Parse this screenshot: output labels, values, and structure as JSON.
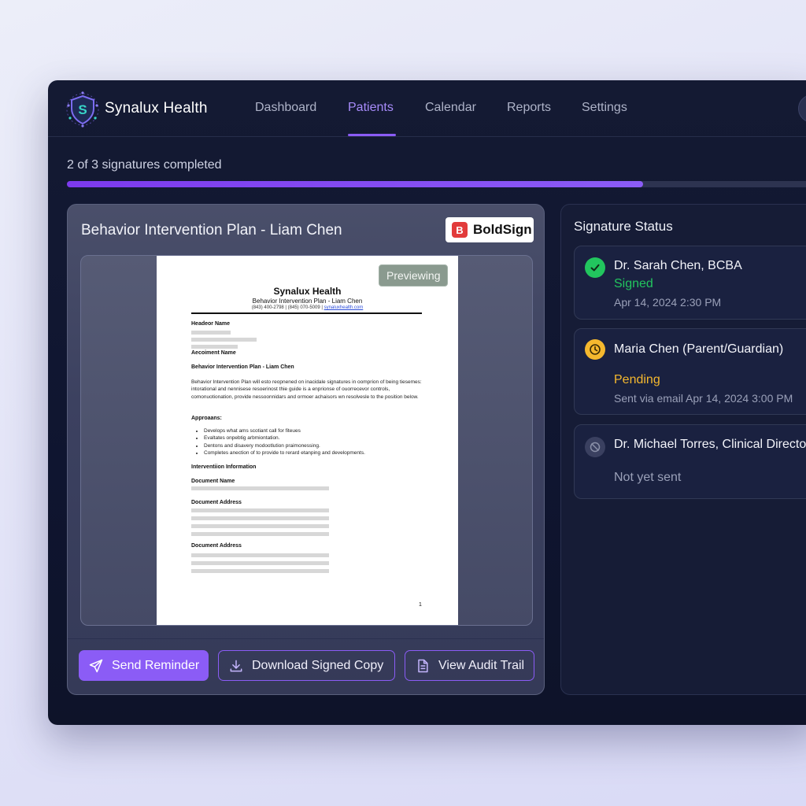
{
  "app": {
    "brand": "Synalux Health",
    "logo_letter": "S"
  },
  "nav": [
    {
      "label": "Dashboard",
      "active": false
    },
    {
      "label": "Patients",
      "active": true
    },
    {
      "label": "Calendar",
      "active": false
    },
    {
      "label": "Reports",
      "active": false
    },
    {
      "label": "Settings",
      "active": false
    }
  ],
  "progress": {
    "text": "2 of 3 signatures completed",
    "completed": 2,
    "total": 3,
    "fraction": 0.762
  },
  "document": {
    "title": "Behavior Intervention Plan - Liam Chen",
    "provider": {
      "name": "BoldSign",
      "icon": "B"
    },
    "preview_badge": "Previewing",
    "paper": {
      "org": "Synalux Health",
      "subtitle": "Behavior Intervention Plan - Liam Chen",
      "contact": "(843) 400-2798 | (845) 070-5009 |",
      "contact_email": "synaluxhealth.com",
      "label_header_name": "Headeor Name",
      "label_account_name": "Aecoiment Name",
      "section_title": "Behavior Intervention Plan - Liam Chen",
      "body": "Behavior Intervention Plan will esto reopnened on inacidale signatures in oomprion of being tiesemes: intorational and nennisese resoerinost thie guide is a enprionse of ouorrecevor controls, comonuotionation, provide nessoonnidars and ormoer achaisors wn resolvesle to the position below.",
      "approaches_label": "Approaans:",
      "approaches": [
        "Develops what ams scotiant call for fiteues",
        "Evaltates onpebtig arbmiontation.",
        "Dentons and disavery modootlution praimonessing.",
        "Completes anection of to provide to rerard etanping and developments."
      ],
      "intervention_label": "Interventiion Information",
      "doc_name_label": "Document Name",
      "doc_address_label_1": "Document Address",
      "doc_address_label_2": "Document Address",
      "page_number": "1"
    }
  },
  "actions": {
    "send_reminder": "Send Reminder",
    "download": "Download Signed Copy",
    "audit": "View Audit Trail"
  },
  "signature_status": {
    "title": "Signature Status",
    "signers": [
      {
        "name": "Dr. Sarah Chen, BCBA",
        "status": "Signed",
        "meta": "Apr 14, 2024 2:30 PM",
        "icon": "check-icon",
        "color": "#22c55e"
      },
      {
        "name": "Maria Chen (Parent/Guardian)",
        "status": "Pending",
        "meta": "Sent via email Apr 14, 2024 3:00 PM",
        "icon": "clock-icon",
        "color": "#f5b82e"
      },
      {
        "name": "Dr. Michael Torres, Clinical Director",
        "status": "Not yet sent",
        "meta": "",
        "icon": "unsent-icon",
        "color": "#4b5270"
      }
    ]
  },
  "colors": {
    "accent": "#8b5cf6",
    "signed": "#22c55e",
    "pending": "#f5b82e",
    "muted": "#9aa0b8"
  }
}
